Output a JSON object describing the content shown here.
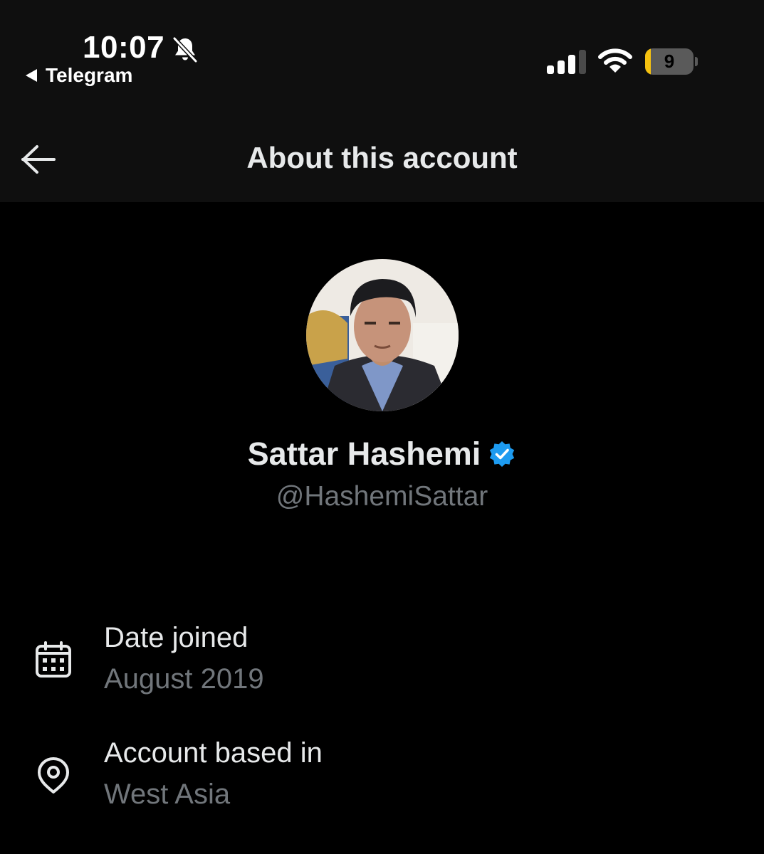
{
  "status_bar": {
    "time": "10:07",
    "back_app": "Telegram",
    "battery_level": "9",
    "battery_fraction": 0.09,
    "icons": [
      "bell-slash-icon",
      "signal-icon",
      "wifi-icon",
      "battery-icon"
    ],
    "colors": {
      "battery_fill": "#f6c20f",
      "battery_body": "#5a5a5a"
    }
  },
  "header": {
    "title": "About this account",
    "back_icon": "back-arrow-icon"
  },
  "profile": {
    "display_name": "Sattar Hashemi",
    "handle": "@HashemiSattar",
    "verified": true,
    "verified_color": "#1d9bf0",
    "avatar_icon": "profile-photo"
  },
  "details": {
    "date_joined": {
      "label": "Date joined",
      "value": "August 2019",
      "icon": "calendar-icon"
    },
    "based_in": {
      "label": "Account based in",
      "value": "West Asia",
      "icon": "location-pin-icon"
    }
  },
  "colors": {
    "background": "#000000",
    "header_bg": "#0f0f0f",
    "primary_text": "#e7e9ea",
    "secondary_text": "#71767b"
  }
}
